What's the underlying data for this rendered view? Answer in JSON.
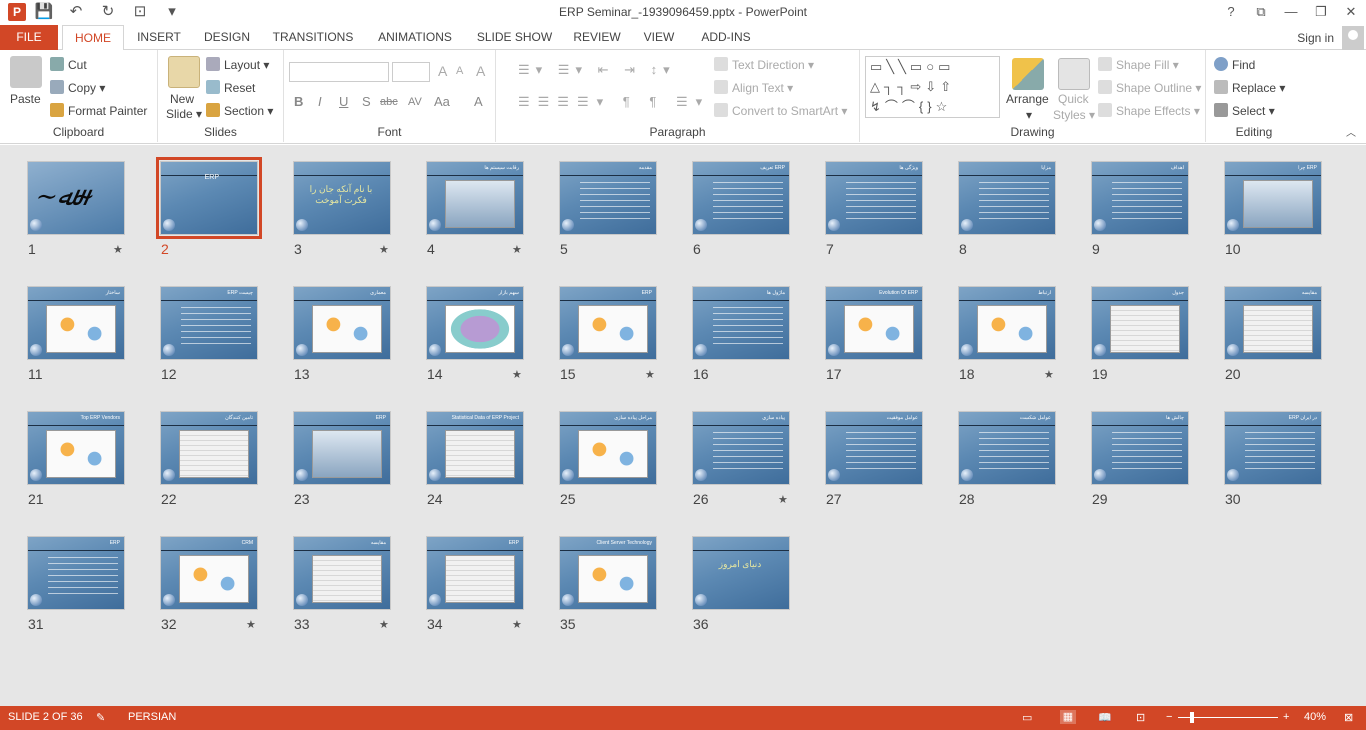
{
  "titlebar": {
    "app_icon": "P",
    "title": "ERP Seminar_-1939096459.pptx - PowerPoint",
    "qat": [
      {
        "name": "save-icon",
        "glyph": "💾"
      },
      {
        "name": "undo-icon",
        "glyph": "↶"
      },
      {
        "name": "redo-icon",
        "glyph": "↻"
      },
      {
        "name": "start-from-beginning-icon",
        "glyph": "⊡"
      },
      {
        "name": "customize-qat-icon",
        "glyph": "▾"
      }
    ],
    "window_controls": [
      "?",
      "⧉",
      "—",
      "❐",
      "✕"
    ]
  },
  "ribbon_tabs": {
    "file": "FILE",
    "items": [
      "HOME",
      "INSERT",
      "DESIGN",
      "TRANSITIONS",
      "ANIMATIONS",
      "SLIDE SHOW",
      "REVIEW",
      "VIEW",
      "ADD-INS"
    ],
    "active": "HOME",
    "signin": "Sign in"
  },
  "clipboard": {
    "paste": "Paste",
    "cut": "Cut",
    "copy": "Copy",
    "format_painter": "Format Painter",
    "label": "Clipboard"
  },
  "slides_group": {
    "new_slide": "New",
    "new_slide_2": "Slide",
    "layout": "Layout",
    "reset": "Reset",
    "section": "Section",
    "label": "Slides"
  },
  "font_group": {
    "bold": "B",
    "italic": "I",
    "underline": "U",
    "shadow": "S",
    "strike": "abc",
    "spacing": "AV",
    "case": "Aa",
    "color": "A",
    "grow": "A",
    "shrink": "A",
    "clear": "A",
    "label": "Font"
  },
  "paragraph": {
    "text_direction": "Text Direction",
    "align_text": "Align Text",
    "convert_smartart": "Convert to SmartArt",
    "label": "Paragraph"
  },
  "drawing": {
    "shapes_row1": "▭╲╲▭○▭",
    "shapes_row2": "△┐┐⇨⇩⇧",
    "shapes_row3": "↯⌒⌒{}☆",
    "arrange": "Arrange",
    "quick_styles": "Quick",
    "quick_styles_2": "Styles",
    "shape_fill": "Shape Fill",
    "shape_outline": "Shape Outline",
    "shape_effects": "Shape Effects",
    "label": "Drawing"
  },
  "editing": {
    "find": "Find",
    "replace": "Replace",
    "select": "Select",
    "label": "Editing"
  },
  "slides": [
    {
      "n": "1",
      "star": true,
      "kind": "calligraphy",
      "title": ""
    },
    {
      "n": "2",
      "star": false,
      "kind": "title",
      "title": "ERP",
      "selected": true
    },
    {
      "n": "3",
      "star": true,
      "kind": "bigtext",
      "title": "با نام آنکه جان را فکرت آموخت"
    },
    {
      "n": "4",
      "star": true,
      "kind": "photo",
      "title": "رقابت سیستم ها"
    },
    {
      "n": "5",
      "star": false,
      "kind": "text",
      "title": "مقدمه"
    },
    {
      "n": "6",
      "star": false,
      "kind": "text",
      "title": "تعریف ERP"
    },
    {
      "n": "7",
      "star": false,
      "kind": "text",
      "title": "ویژگی ها"
    },
    {
      "n": "8",
      "star": false,
      "kind": "text",
      "title": "مزایا"
    },
    {
      "n": "9",
      "star": false,
      "kind": "text",
      "title": "اهداف"
    },
    {
      "n": "10",
      "star": false,
      "kind": "photo",
      "title": "چرا ERP"
    },
    {
      "n": "11",
      "star": false,
      "kind": "diagram",
      "title": "ساختار"
    },
    {
      "n": "12",
      "star": false,
      "kind": "text",
      "title": "ERP چیست"
    },
    {
      "n": "13",
      "star": false,
      "kind": "diagram",
      "title": "معماری"
    },
    {
      "n": "14",
      "star": true,
      "kind": "chart",
      "title": "سهم بازار"
    },
    {
      "n": "15",
      "star": true,
      "kind": "diagram",
      "title": "ERP"
    },
    {
      "n": "16",
      "star": false,
      "kind": "text",
      "title": "ماژول ها"
    },
    {
      "n": "17",
      "star": false,
      "kind": "diagram",
      "title": "Evolution Of ERP"
    },
    {
      "n": "18",
      "star": true,
      "kind": "diagram",
      "title": "ارتباط"
    },
    {
      "n": "19",
      "star": false,
      "kind": "table",
      "title": "جدول"
    },
    {
      "n": "20",
      "star": false,
      "kind": "table",
      "title": "مقایسه"
    },
    {
      "n": "21",
      "star": false,
      "kind": "diagram",
      "title": "Top ERP Vendors"
    },
    {
      "n": "22",
      "star": false,
      "kind": "table",
      "title": "تامین کنندگان"
    },
    {
      "n": "23",
      "star": false,
      "kind": "photo",
      "title": "ERP"
    },
    {
      "n": "24",
      "star": false,
      "kind": "table",
      "title": "Statistical Data of ERP Project"
    },
    {
      "n": "25",
      "star": false,
      "kind": "diagram",
      "title": "مراحل پیاده سازی"
    },
    {
      "n": "26",
      "star": true,
      "kind": "text",
      "title": "پیاده سازی"
    },
    {
      "n": "27",
      "star": false,
      "kind": "text",
      "title": "عوامل موفقیت"
    },
    {
      "n": "28",
      "star": false,
      "kind": "text",
      "title": "عوامل شکست"
    },
    {
      "n": "29",
      "star": false,
      "kind": "text",
      "title": "چالش ها"
    },
    {
      "n": "30",
      "star": false,
      "kind": "text",
      "title": "ERP در ایران"
    },
    {
      "n": "31",
      "star": false,
      "kind": "text",
      "title": "ERP"
    },
    {
      "n": "32",
      "star": true,
      "kind": "diagram",
      "title": "CRM"
    },
    {
      "n": "33",
      "star": true,
      "kind": "table",
      "title": "مقایسه"
    },
    {
      "n": "34",
      "star": true,
      "kind": "table",
      "title": "ERP"
    },
    {
      "n": "35",
      "star": false,
      "kind": "diagram",
      "title": "Client Server Technology"
    },
    {
      "n": "36",
      "star": false,
      "kind": "bigtext",
      "title": "دنیای امروز"
    }
  ],
  "statusbar": {
    "slide_info": "SLIDE 2 OF 36",
    "language": "PERSIAN",
    "zoom": "40%"
  }
}
